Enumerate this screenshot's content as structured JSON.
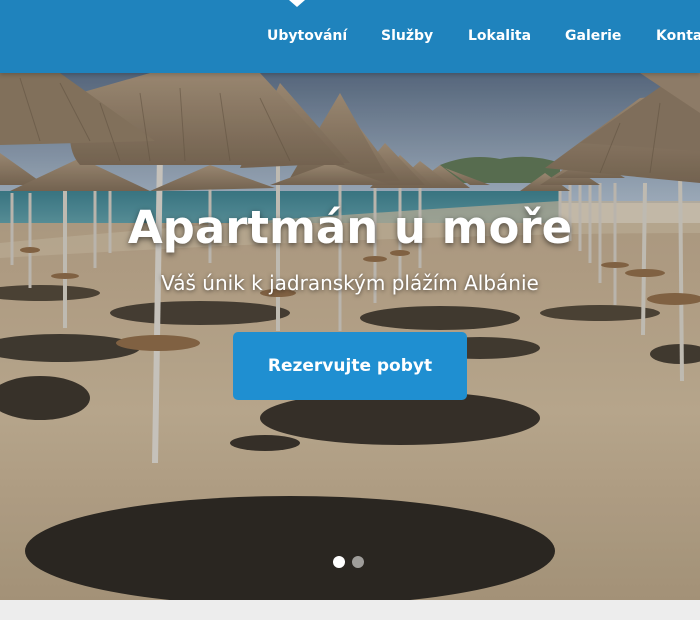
{
  "nav": {
    "items": [
      {
        "label": "Ubytování"
      },
      {
        "label": "Služby"
      },
      {
        "label": "Lokalita"
      },
      {
        "label": "Galerie"
      },
      {
        "label": "Kontakt"
      }
    ]
  },
  "hero": {
    "title": "Apartmán u moře",
    "subtitle": "Váš únik k jadranským plážím Albánie",
    "cta_label": "Rezervujte pobyt",
    "image_alt": "beach-parasols-photo"
  },
  "carousel": {
    "slide_count": 2,
    "active_index": 0
  },
  "colors": {
    "navbar": "#1f83bd",
    "accent": "#1f8fd1"
  }
}
